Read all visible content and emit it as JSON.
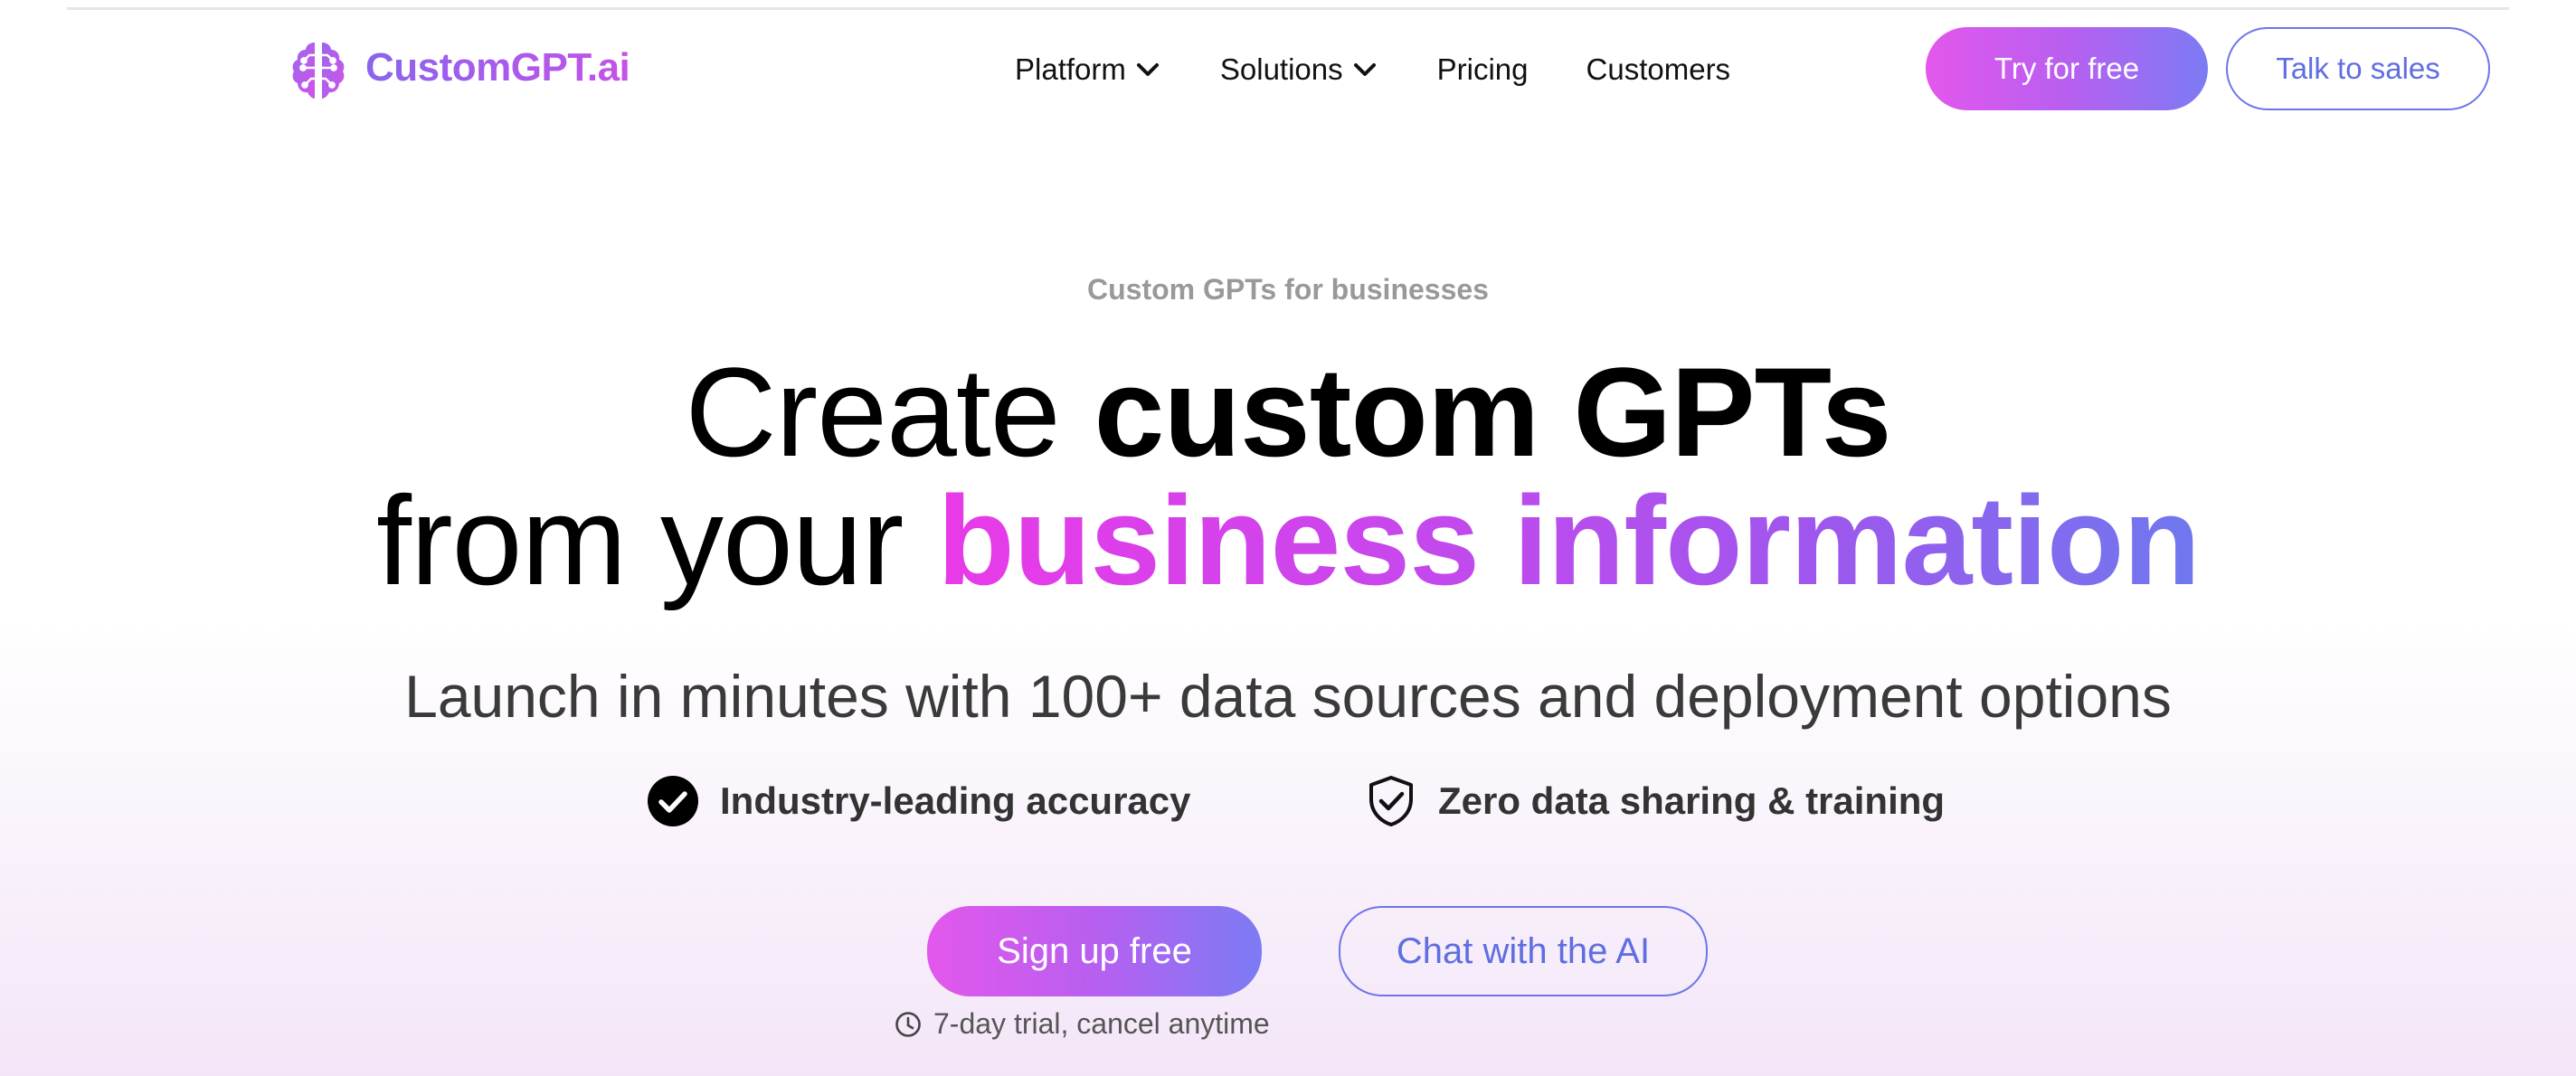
{
  "brand": {
    "name": "CustomGPT.ai",
    "accent": "#c552e8",
    "accent_alt": "#7c7bf4"
  },
  "nav": {
    "items": [
      {
        "label": "Platform",
        "has_dropdown": true
      },
      {
        "label": "Solutions",
        "has_dropdown": true
      },
      {
        "label": "Pricing",
        "has_dropdown": false
      },
      {
        "label": "Customers",
        "has_dropdown": false
      }
    ],
    "try_label": "Try for free",
    "talk_label": "Talk to sales"
  },
  "hero": {
    "eyebrow": "Custom GPTs for businesses",
    "headline_line1_regular": "Create ",
    "headline_line1_bold": "custom GPTs",
    "headline_line2_regular": "from your ",
    "headline_line2_gradient": "business information",
    "subhead": "Launch in minutes with 100+ data sources and deployment options",
    "features": [
      {
        "icon": "check-circle-icon",
        "label": "Industry-leading accuracy"
      },
      {
        "icon": "shield-check-icon",
        "label": "Zero data sharing & training"
      }
    ],
    "primary_cta": "Sign up free",
    "secondary_cta": "Chat with the AI",
    "trial_note": "7-day trial, cancel anytime",
    "trial_icon": "clock-icon"
  }
}
